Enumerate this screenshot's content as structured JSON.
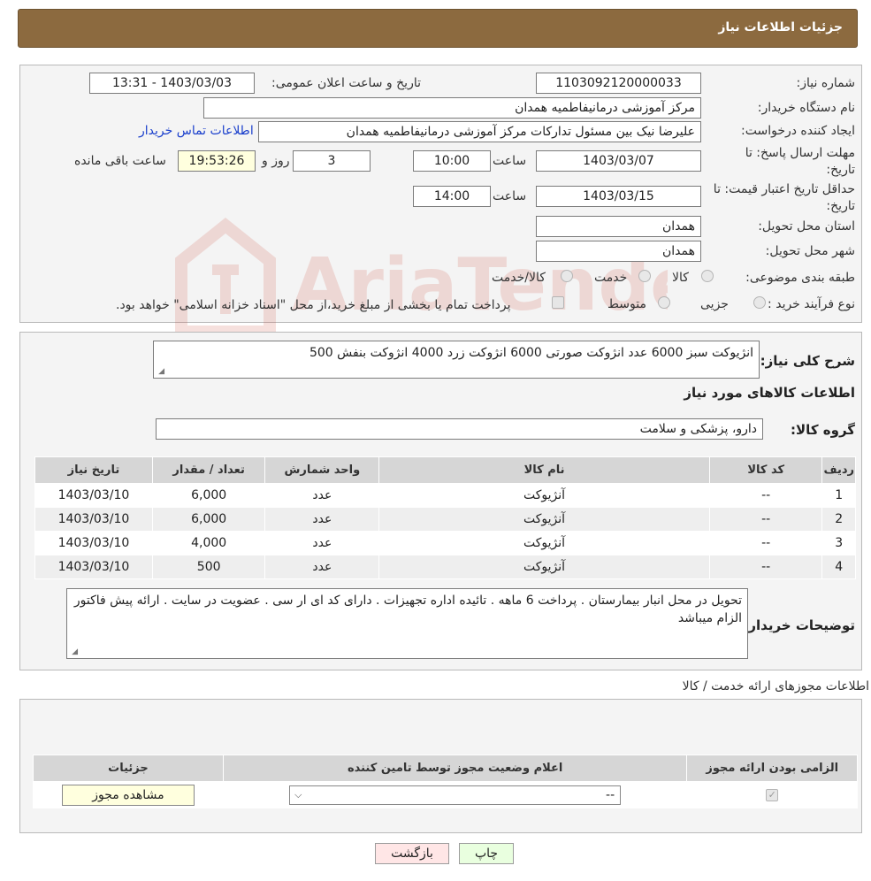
{
  "header": {
    "title": "جزئیات اطلاعات نیاز"
  },
  "form": {
    "need_number_label": "شماره نیاز:",
    "need_number": "1103092120000033",
    "announce_label": "تاریخ و ساعت اعلان عمومی:",
    "announce_value": "1403/03/03 - 13:31",
    "buyer_org_label": "نام دستگاه خریدار:",
    "buyer_org": "مرکز آموزشی درمانیفاطمیه همدان",
    "requester_label": "ایجاد کننده درخواست:",
    "requester": "علیرضا نیک بین مسئول تدارکات مرکز آموزشی درمانیفاطمیه همدان",
    "contact_link": "اطلاعات تماس خریدار",
    "deadline_label": "مهلت ارسال پاسخ: تا تاریخ:",
    "deadline_date": "1403/03/07",
    "time_label": "ساعت",
    "deadline_time": "10:00",
    "days_value": "3",
    "days_label": "روز و",
    "remaining_time": "19:53:26",
    "remaining_label": "ساعت باقی مانده",
    "validity_label": "حداقل تاریخ اعتبار قیمت: تا تاریخ:",
    "validity_date": "1403/03/15",
    "validity_time": "14:00",
    "province_label": "استان محل تحویل:",
    "province": "همدان",
    "city_label": "شهر محل تحویل:",
    "city": "همدان",
    "category_label": "طبقه بندی موضوعی:",
    "category_options": [
      "کالا",
      "خدمت",
      "کالا/خدمت"
    ],
    "process_label": "نوع فرآیند خرید :",
    "process_options": [
      "جزیی",
      "متوسط"
    ],
    "process_note": "پرداخت تمام یا بخشی از مبلغ خرید،از محل \"اسناد خزانه اسلامی\" خواهد بود."
  },
  "description": {
    "label": "شرح کلی نیاز:",
    "text": "انژیوکت سبز 6000 عدد انژوکت صورتی 6000 انژوکت زرد 4000 انژوکت بنفش 500"
  },
  "goods": {
    "section_title": "اطلاعات کالاهای مورد نیاز",
    "group_label": "گروه کالا:",
    "group_value": "دارو، پزشکی و سلامت",
    "columns": [
      "ردیف",
      "کد کالا",
      "نام کالا",
      "واحد شمارش",
      "تعداد / مقدار",
      "تاریخ نیاز"
    ],
    "rows": [
      [
        "1",
        "--",
        "آنژیوکت",
        "عدد",
        "6,000",
        "1403/03/10"
      ],
      [
        "2",
        "--",
        "آنژیوکت",
        "عدد",
        "6,000",
        "1403/03/10"
      ],
      [
        "3",
        "--",
        "آنژیوکت",
        "عدد",
        "4,000",
        "1403/03/10"
      ],
      [
        "4",
        "--",
        "آنژیوکت",
        "عدد",
        "500",
        "1403/03/10"
      ]
    ]
  },
  "buyer_notes": {
    "label": "توضیحات خریدار:",
    "text": "تحویل در محل انبار بیمارستان . پرداخت 6 ماهه . تائیده اداره تجهیزات . دارای کد ای ار سی . عضویت در سایت . ارائه پیش فاکتور الزام میباشد"
  },
  "permits": {
    "section_title": "اطلاعات مجوزهای ارائه خدمت / کالا",
    "columns": [
      "الزامی بودن ارائه مجوز",
      "اعلام وضعیت مجوز توسط تامین کننده",
      "جزئیات"
    ],
    "select_value": "--",
    "view_button": "مشاهده مجوز"
  },
  "footer": {
    "print_button": "چاپ",
    "back_button": "بازگشت"
  },
  "watermark_text": "AriaTender.neT"
}
